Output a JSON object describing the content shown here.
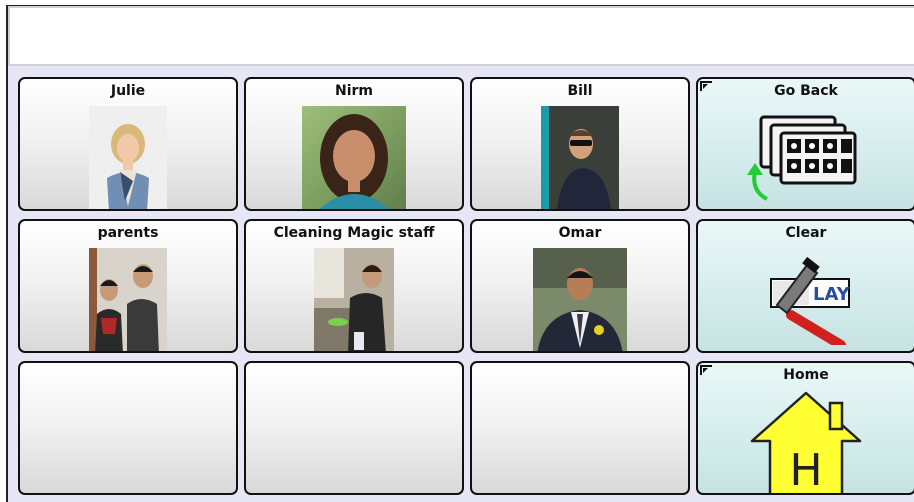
{
  "display_bar": {
    "text": ""
  },
  "cells": {
    "julie": {
      "label": "Julie"
    },
    "nirm": {
      "label": "Nirm"
    },
    "bill": {
      "label": "Bill"
    },
    "go_back": {
      "label": "Go Back"
    },
    "parents": {
      "label": "parents"
    },
    "cleaning": {
      "label": "Cleaning Magic staff"
    },
    "omar": {
      "label": "Omar"
    },
    "clear": {
      "label": "Clear",
      "icon_text": "LAY"
    },
    "home": {
      "label": "Home",
      "icon_text": "H"
    }
  },
  "colors": {
    "grid_bg": "#e6e6f4",
    "cell_default": "#f2f2f2",
    "cell_nav": "#d8eeee",
    "home_house": "#ffff33",
    "back_arrow": "#22cc33"
  }
}
